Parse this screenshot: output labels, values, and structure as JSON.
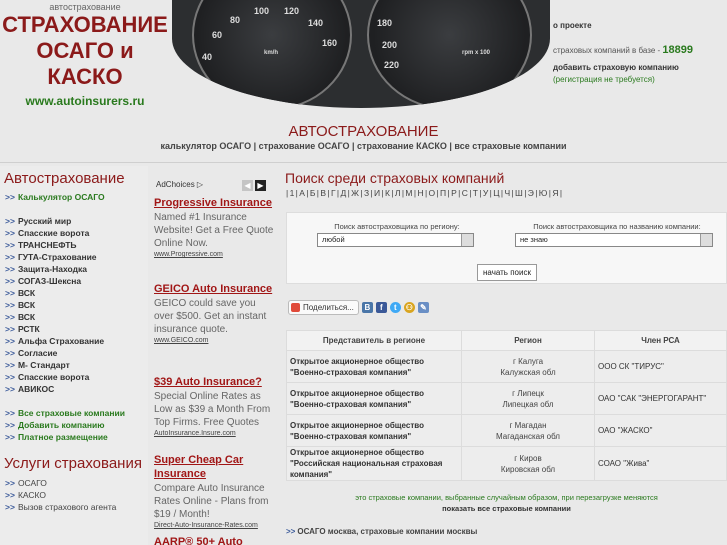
{
  "header": {
    "small_label": "автострахование",
    "title_line1": "СТРАХОВАНИЕ",
    "title_line2": "ОСАГО и КАСКО",
    "url": "www.autoinsurers.ru",
    "about_link": "о проекте",
    "companies_label": "страховых компаний в базе -",
    "companies_count": "18899",
    "add_company": "добавить страховую компанию",
    "no_registration": "(регистрация не требуется)",
    "dash_numbers": [
      "60",
      "80",
      "100",
      "120",
      "140",
      "160",
      "180",
      "200",
      "220",
      "40",
      "km/h",
      "rpm x 100"
    ]
  },
  "section": {
    "title": "АВТОСТРАХОВАНИЕ",
    "links": "калькулятор ОСАГО | страхование ОСАГО | страхование КАСКО | все страховые компании"
  },
  "sidebar": {
    "title": "Автострахование",
    "calc": "Калькулятор ОСАГО",
    "items": [
      "Русский мир",
      "Спасские ворота",
      "ТРАНСНЕФТЬ",
      "ГУТА-Страхование",
      "Защита-Находка",
      "СОГАЗ-Шексна",
      "ВСК",
      "ВСК",
      "ВСК",
      "РСТК",
      "Альфа Страхование",
      "Согласие",
      "М- Стандарт",
      "Спасские ворота",
      "АВИКОС"
    ],
    "green_links": [
      "Все страховые компании",
      "Добавить компанию",
      "Платное размещение"
    ],
    "services_title": "Услуги страхования",
    "services": [
      "ОСАГО",
      "КАСКО",
      "Вызов страхового агента"
    ],
    "arrow": ">>"
  },
  "ads": {
    "adchoices": "AdChoices",
    "items": [
      {
        "title": "Progressive Insurance",
        "desc": "Named #1 Insurance Website! Get a Free Quote Online Now.",
        "url": "www.Progressive.com"
      },
      {
        "title": "GEICO Auto Insurance",
        "desc": "GEICO could save you over $500. Get an instant insurance quote.",
        "url": "www.GEICO.com"
      },
      {
        "title": "$39 Auto Insurance?",
        "desc": "Special Online Rates as Low as $39 a Month From Top Firms. Free Quotes",
        "url": "AutoInsurance.Insure.com"
      },
      {
        "title": "Super Cheap Car Insurance",
        "desc": "Compare Auto Insurance Rates Online - Plans from $19 / Month!",
        "url": "Direct-Auto-Insurance-Rates.com"
      },
      {
        "title": "AARP® 50+ Auto",
        "desc": "",
        "url": ""
      }
    ]
  },
  "main": {
    "title": "Поиск среди страховых компаний",
    "alphabet": "| 1 | А | Б | В | Г | Д | Ж | З | И | К | Л | М | Н | О | П | Р | С | Т | У | Ц | Ч | Ш | Э | Ю | Я |",
    "search": {
      "region_label": "Поиск автостраховщика по региону:",
      "region_value": "любой",
      "name_label": "Поиск автостраховщика по названию компании:",
      "name_value": "не знаю",
      "button": "начать поиск"
    },
    "share_label": "Поделиться...",
    "table": {
      "headers": [
        "Представитель в регионе",
        "Регион",
        "Член РСА"
      ],
      "rows": [
        {
          "rep": "Открытое акционерное общество \"Военно-страховая компания\"",
          "city": "г Калуга",
          "region": "Калужская обл",
          "member": "ООО СК \"ТИРУС\""
        },
        {
          "rep": "Открытое акционерное общество \"Военно-страховая компания\"",
          "city": "г Липецк",
          "region": "Липецкая обл",
          "member": "ОАО \"САК \"ЭНЕРГОГАРАНТ\""
        },
        {
          "rep": "Открытое акционерное общество \"Военно-страховая компания\"",
          "city": "г Магадан",
          "region": "Магаданская обл",
          "member": "ОАО \"ЖАСКО\""
        },
        {
          "rep": "Открытое акционерное общество \"Российская национальная страховая компания\"",
          "city": "г Киров",
          "region": "Кировская обл",
          "member": "СОАО \"Жива\""
        }
      ]
    },
    "note": "это страховые компании, выбранные случайным образом, при перезагрузке меняются",
    "show_all": "показать все страховые компании",
    "footer_link": "ОСАГО москва, страховые компании москвы"
  },
  "colors": {
    "brand_red": "#8b1a1a",
    "green": "#2a7a1e",
    "link_blue": "#3b5a9a"
  }
}
